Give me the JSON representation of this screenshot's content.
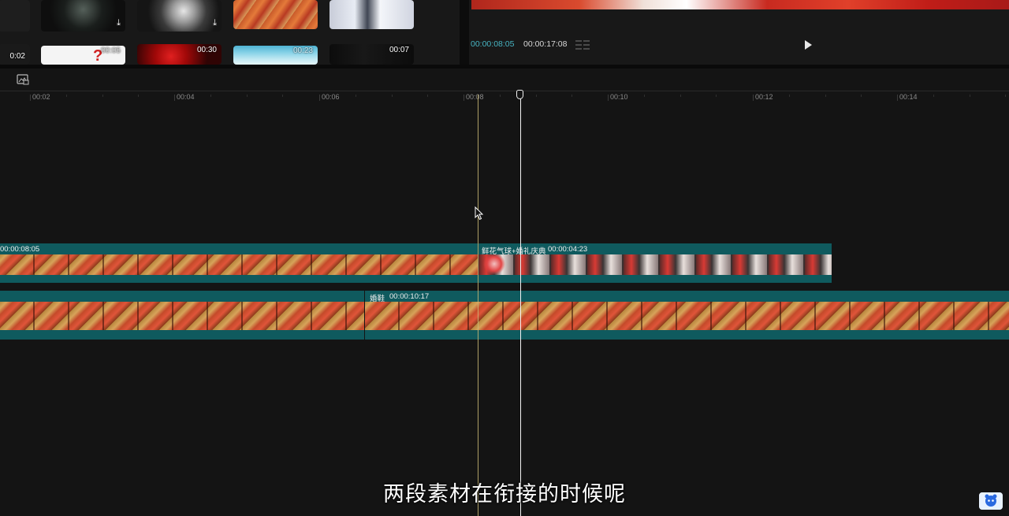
{
  "media": {
    "thumbs": [
      {
        "duration": ""
      },
      {
        "duration": ""
      },
      {
        "duration": ""
      },
      {
        "duration": ""
      },
      {
        "duration": ""
      },
      {
        "duration": "0:02"
      },
      {
        "duration": "00:05"
      },
      {
        "duration": "00:30"
      },
      {
        "duration": "00:23"
      },
      {
        "duration": "00:07"
      }
    ]
  },
  "preview": {
    "current_time": "00:00:08:05",
    "total_time": "00:00:17:08"
  },
  "timeline": {
    "ruler_labels": [
      "00:02",
      "00:04",
      "00:06",
      "00:08",
      "00:10",
      "00:12",
      "00:14"
    ],
    "track1": {
      "left_clip_duration": "00:00:08:05",
      "right_clip_name": "鲜花气球+婚礼庆典",
      "right_clip_duration": "00:00:04:23"
    },
    "track2": {
      "clip_name": "婚鞋",
      "clip_duration": "00:00:10:17"
    }
  },
  "subtitle": "两段素材在衔接的时候呢",
  "colors": {
    "accent": "#47b4c2",
    "clip": "#0f5a5e",
    "playhead": "#f2f2f2",
    "snapline": "#c9b774"
  },
  "icons": {
    "download": "download-icon",
    "play": "play-icon",
    "grid": "grid-icon",
    "toolbar": "image-toggle-icon"
  }
}
